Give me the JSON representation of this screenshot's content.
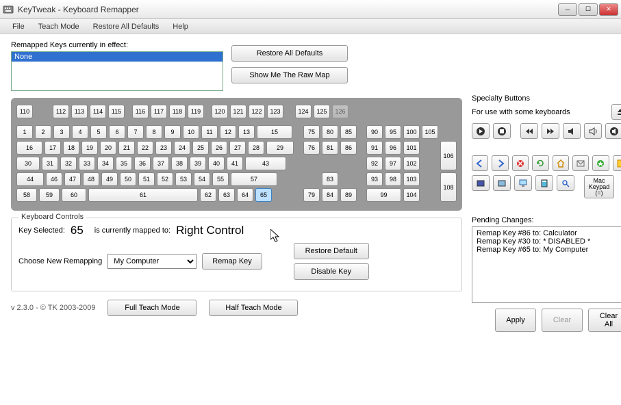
{
  "window": {
    "title": "KeyTweak -   Keyboard Remapper"
  },
  "menu": [
    "File",
    "Teach Mode",
    "Restore All Defaults",
    "Help"
  ],
  "remapped": {
    "label": "Remapped Keys currently in effect:",
    "items": [
      "None"
    ],
    "restore": "Restore All Defaults",
    "raw": "Show Me The Raw Map"
  },
  "keyboard": {
    "fn_row": [
      [
        "110"
      ],
      [
        "112",
        "113",
        "114",
        "115"
      ],
      [
        "116",
        "117",
        "118",
        "119"
      ],
      [
        "120",
        "121",
        "122",
        "123"
      ],
      [
        "124",
        "125",
        "126"
      ]
    ],
    "main_rows": [
      [
        "1",
        "2",
        "3",
        "4",
        "5",
        "6",
        "7",
        "8",
        "9",
        "10",
        "11",
        "12",
        "13",
        "15"
      ],
      [
        "16",
        "17",
        "18",
        "19",
        "20",
        "21",
        "22",
        "23",
        "24",
        "25",
        "26",
        "27",
        "28",
        "29"
      ],
      [
        "30",
        "31",
        "32",
        "33",
        "34",
        "35",
        "36",
        "37",
        "38",
        "39",
        "40",
        "41",
        "43"
      ],
      [
        "44",
        "46",
        "47",
        "48",
        "49",
        "50",
        "51",
        "52",
        "53",
        "54",
        "55",
        "57"
      ],
      [
        "58",
        "59",
        "60",
        "61",
        "62",
        "63",
        "64",
        "65"
      ]
    ],
    "nav_rows": [
      [
        "75",
        "80",
        "85"
      ],
      [
        "76",
        "81",
        "86"
      ],
      [],
      [
        "83"
      ],
      [
        "79",
        "84",
        "89"
      ]
    ],
    "num_rows": [
      [
        "90",
        "95",
        "100",
        "105"
      ],
      [
        "91",
        "96",
        "101"
      ],
      [
        "92",
        "97",
        "102"
      ],
      [
        "93",
        "98",
        "103"
      ],
      [
        "99",
        "104"
      ]
    ],
    "num_tall": [
      "106",
      "108"
    ],
    "selected": "65"
  },
  "controls": {
    "group": "Keyboard Controls",
    "key_selected_label": "Key Selected:",
    "key_selected": "65",
    "mapped_label": "is currently mapped to:",
    "mapped_to": "Right Control",
    "choose_label": "Choose New Remapping",
    "choose_value": "My Computer",
    "remap": "Remap Key",
    "restore": "Restore Default",
    "disable": "Disable Key"
  },
  "footer": {
    "version": "v 2.3.0 - © TK 2003-2009",
    "full": "Full Teach Mode",
    "half": "Half Teach Mode"
  },
  "specialty": {
    "title": "Specialty Buttons",
    "subtitle": "For use with some keyboards",
    "mac": "Mac Keypad (=)"
  },
  "pending": {
    "title": "Pending Changes:",
    "lines": [
      "Remap Key #86 to: Calculator",
      "Remap Key #30 to: * DISABLED *",
      "Remap Key #65 to: My Computer"
    ],
    "apply": "Apply",
    "clear": "Clear",
    "clear_all": "Clear All"
  }
}
